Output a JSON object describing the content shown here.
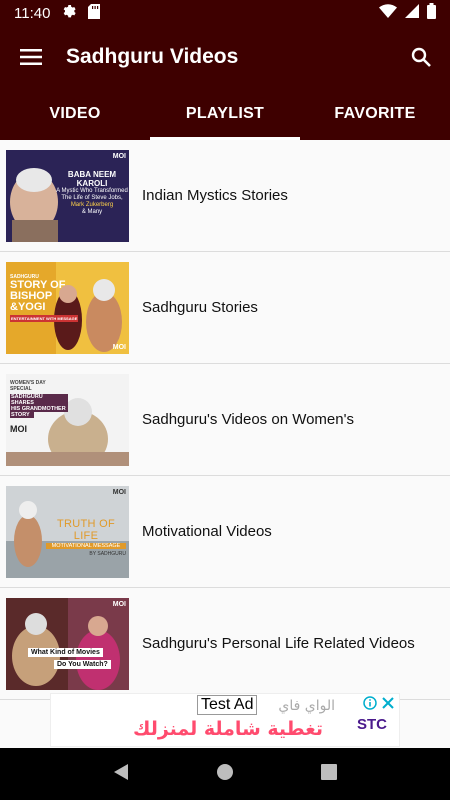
{
  "status_bar": {
    "time": "11:40"
  },
  "app_bar": {
    "title": "Sadhguru Videos"
  },
  "tabs": [
    {
      "label": "VIDEO",
      "active": false
    },
    {
      "label": "PLAYLIST",
      "active": true
    },
    {
      "label": "FAVORITE",
      "active": false
    }
  ],
  "playlists": [
    {
      "title": "Indian Mystics Stories",
      "thumb_text": [
        "BABA NEEM KAROLI",
        "A Mystic Who Transformed",
        "The Life of Steve Jobs,",
        "Mark Zukerberg",
        "& Many"
      ],
      "thumb_logo": "MOI"
    },
    {
      "title": "Sadhguru Stories",
      "thumb_text": [
        "SADHGURU",
        "STORY OF",
        "BISHOP",
        "&YOGI",
        "ENTERTAINMENT WITH MESSAGE"
      ],
      "thumb_logo": "MOI"
    },
    {
      "title": "Sadhguru's Videos on Women's",
      "thumb_text": [
        "WOMEN'S DAY SPECIAL",
        "SADHGURU SHARES",
        "HIS GRANDMOTHER",
        "STORY",
        "MOI"
      ]
    },
    {
      "title": "Motivational Videos",
      "thumb_text": [
        "TRUTH OF LIFE",
        "MOTIVATIONAL MESSAGE",
        "BY SADHGURU"
      ],
      "thumb_logo": "MOI"
    },
    {
      "title": "Sadhguru's Personal Life Related Videos",
      "thumb_text": [
        "What Kind of Movies",
        "Do You Watch?"
      ],
      "thumb_logo": "MOI"
    }
  ],
  "ad": {
    "label": "Test Ad",
    "top_text": "الواي فاي",
    "main_text": "تغطية شاملة لمنزلك",
    "brand": "STC"
  },
  "colors": {
    "bar": "#3e0000",
    "tab_indicator": "#ffffff"
  }
}
